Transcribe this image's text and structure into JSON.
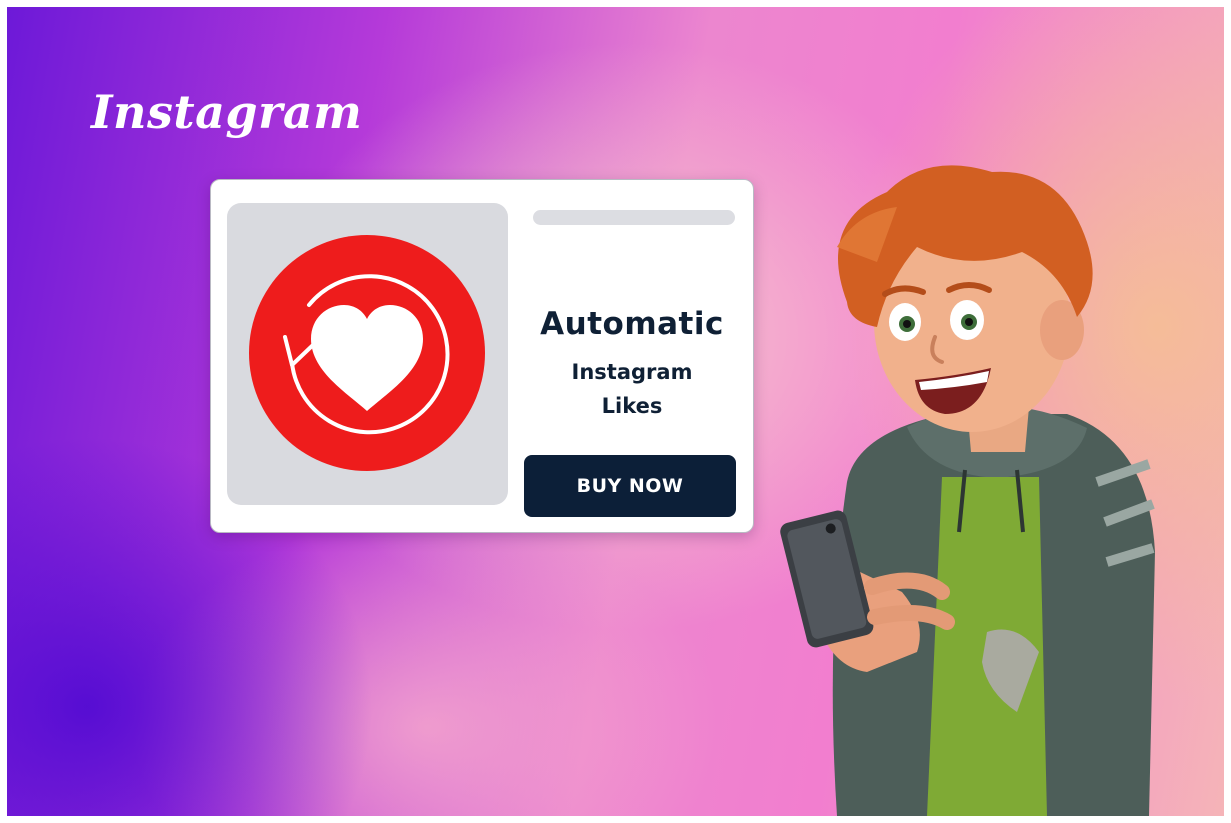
{
  "brand": {
    "logo_text": "Instagram"
  },
  "card": {
    "title_line1": "Automatic",
    "title_line2": "Instagram",
    "title_line3": "Likes",
    "button_label": "BUY NOW",
    "icon": "heart-refresh-icon"
  },
  "colors": {
    "badge_red": "#ee1c1c",
    "button_navy": "#0c1f38",
    "title_navy": "#0f2035"
  }
}
